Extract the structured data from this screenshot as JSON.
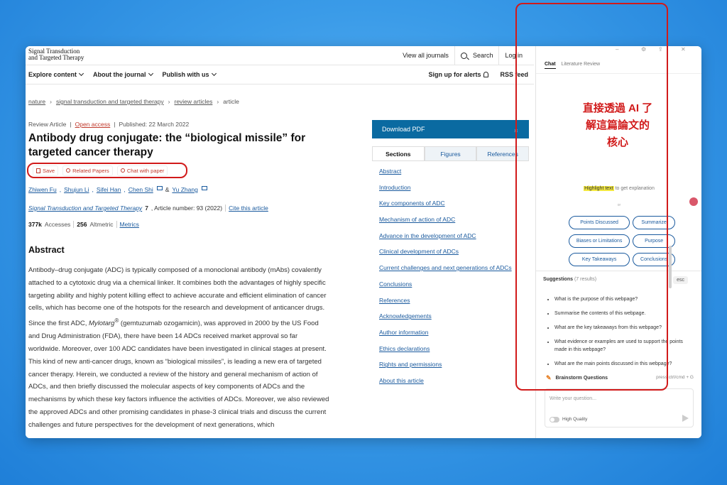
{
  "header": {
    "logo_line1": "Signal Transduction",
    "logo_line2": "and Targeted Therapy",
    "view_journals": "View all journals",
    "search": "Search",
    "login": "Log in"
  },
  "subnav": {
    "explore": "Explore content",
    "about": "About the journal",
    "publish": "Publish with us",
    "alerts": "Sign up for alerts",
    "rss": "RSS feed"
  },
  "breadcrumb": [
    "nature",
    "signal transduction and targeted therapy",
    "review articles",
    "article"
  ],
  "article": {
    "type": "Review Article",
    "open_access": "Open access",
    "published": "Published: 22 March 2022",
    "title": "Antibody drug conjugate: the “biological missile” for targeted cancer therapy",
    "tools": {
      "save": "Save",
      "related": "Related Papers",
      "chat": "Chat with paper"
    },
    "authors": [
      "Zhiwen Fu",
      "Shujun Li",
      "Sifei Han",
      "Chen Shi",
      "Yu Zhang"
    ],
    "authors_amp": "&",
    "journal": "Signal Transduction and Targeted Therapy",
    "volume": "7",
    "article_number": ", Article number: 93 (2022)",
    "cite": "Cite this article",
    "accesses_count": "377k",
    "accesses_label": "Accesses",
    "altmetric_count": "256",
    "altmetric_label": "Altmetric",
    "metrics": "Metrics",
    "abstract_heading": "Abstract",
    "abstract_pre": "Antibody–drug conjugate (ADC) is typically composed of a monoclonal antibody (mAbs) covalently attached to a cytotoxic drug via a chemical linker. It combines both the advantages of highly specific targeting ability and highly potent killing effect to achieve accurate and efficient elimination of cancer cells, which has become one of the hotspots for the research and development of anticancer drugs. Since the first ADC, ",
    "abstract_drug": "Mylotarg",
    "abstract_sup": "®",
    "abstract_post": " (gemtuzumab ozogamicin), was approved in 2000 by the US Food and Drug Administration (FDA), there have been 14 ADCs received market approval so far worldwide. Moreover, over 100 ADC candidates have been investigated in clinical stages at present. This kind of new anti-cancer drugs, known as “biological missiles”, is leading a new era of targeted cancer therapy. Herein, we conducted a review of the history and general mechanism of action of ADCs, and then briefly discussed the molecular aspects of key components of ADCs and the mechanisms by which these key factors influence the activities of ADCs. Moreover, we also reviewed the approved ADCs and other promising candidates in phase-3 clinical trials and discuss the current challenges and future perspectives for the development of next generations, which"
  },
  "sidebar": {
    "download": "Download PDF",
    "tabs": [
      "Sections",
      "Figures",
      "References"
    ],
    "toc": [
      "Abstract",
      "Introduction",
      "Key components of ADC",
      "Mechanism of action of ADC",
      "Advance in the development of ADC",
      "Clinical development of ADCs",
      "Current challenges and next generations of ADCs",
      "Conclusions",
      "References",
      "Acknowledgements",
      "Author information",
      "Ethics declarations",
      "Rights and permissions",
      "About this article"
    ]
  },
  "panel": {
    "tab_chat": "Chat",
    "tab_lit": "Literature Review",
    "headline_l1": "直接透過 AI 了",
    "headline_l2": "解這篇論文的",
    "headline_l3": "核心",
    "highlight_word": "Highlight text",
    "highlight_rest": " to get explanation",
    "or": "or",
    "chips": [
      "Points Discussed",
      "Summarize",
      "Biases or Limitations",
      "Purpose",
      "Key Takeaways",
      "Conclusions"
    ],
    "suggestions_label": "Suggestions",
    "suggestions_count": "(7 results)",
    "esc": "esc",
    "suggestions": [
      "What is the purpose of this webpage?",
      "Summarise the contents of this webpage.",
      "What are the key takeaways from this webpage?",
      "What evidence or examples are used to support the points made in this webpage?",
      "What are the main points discussed in this webpage?"
    ],
    "brainstorm": "Brainstorm Questions",
    "shortcut": "press ctrl/cmd + G",
    "input_placeholder": "Write your question...",
    "high_quality": "High Quality"
  },
  "colors": {
    "accent_red": "#d11a1a",
    "link_blue": "#1a5a9e",
    "pdf_blue": "#0a6aa1"
  }
}
